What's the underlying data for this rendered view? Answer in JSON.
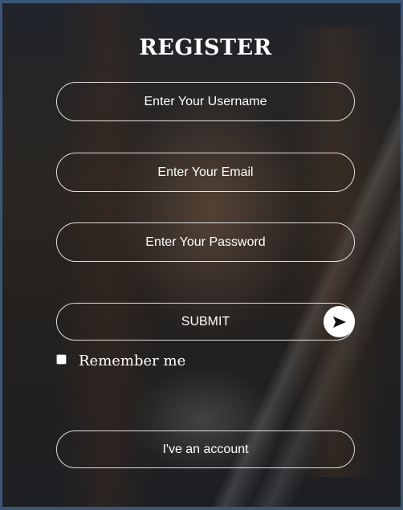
{
  "form": {
    "title": "REGISTER",
    "username_placeholder": "Enter Your Username",
    "email_placeholder": "Enter Your Email",
    "password_placeholder": "Enter Your Password",
    "submit_label": "SUBMIT",
    "send_icon": "send-arrow-icon",
    "remember_label": "Remember me",
    "account_label": "I've an account"
  },
  "colors": {
    "page_border": "#3c5678",
    "text": "#ffffff",
    "field_border": "#ffffff"
  }
}
